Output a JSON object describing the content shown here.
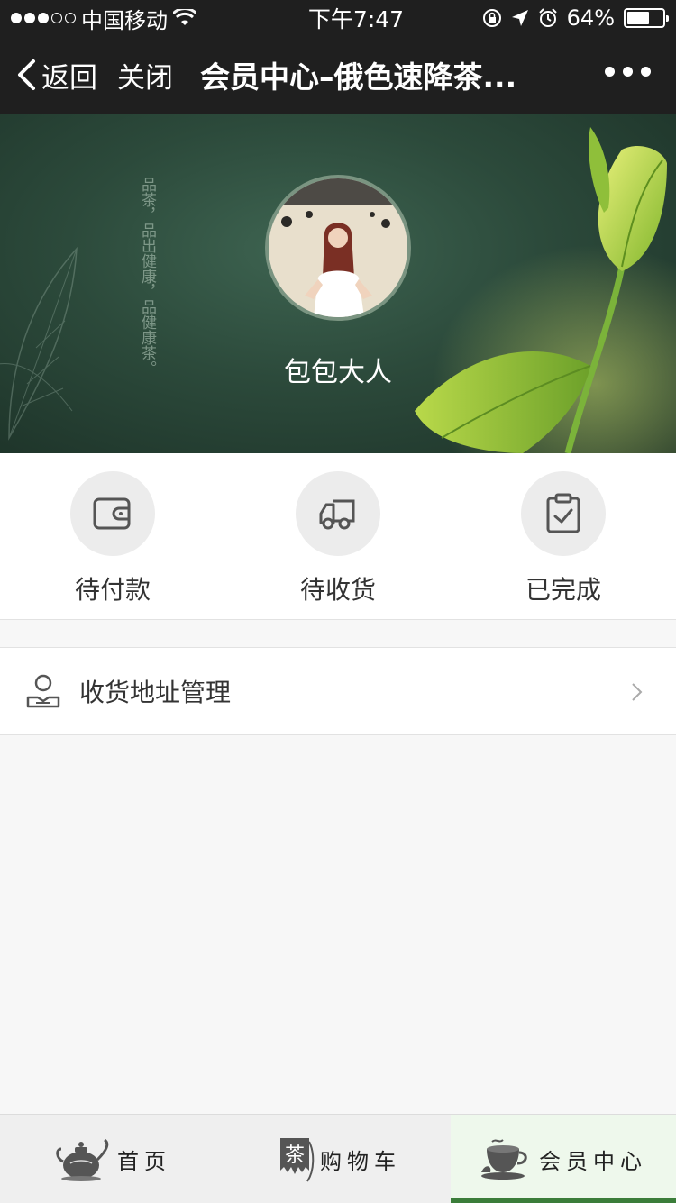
{
  "status_bar": {
    "carrier": "中国移动",
    "time": "下午7:47",
    "battery_text": "64%",
    "battery_level": 0.64
  },
  "nav": {
    "back_label": "返回",
    "close_label": "关闭",
    "title": "会员中心–俄色速降茶..."
  },
  "hero": {
    "vertical_text": "品茶，品出健康，品健康茶。",
    "username": "包包大人"
  },
  "orders": [
    {
      "label": "待付款",
      "icon": "wallet-icon"
    },
    {
      "label": "待收货",
      "icon": "truck-icon"
    },
    {
      "label": "已完成",
      "icon": "clipboard-check-icon"
    }
  ],
  "address": {
    "label": "收货地址管理",
    "icon": "person-address-icon"
  },
  "tabbar": {
    "items": [
      {
        "label": "首页",
        "icon": "teapot-icon"
      },
      {
        "label": "购物车",
        "icon": "tea-banner-icon"
      },
      {
        "label": "会员中心",
        "icon": "tea-cup-icon"
      }
    ],
    "active_index": 2,
    "accent_color": "#3b7d3a"
  }
}
